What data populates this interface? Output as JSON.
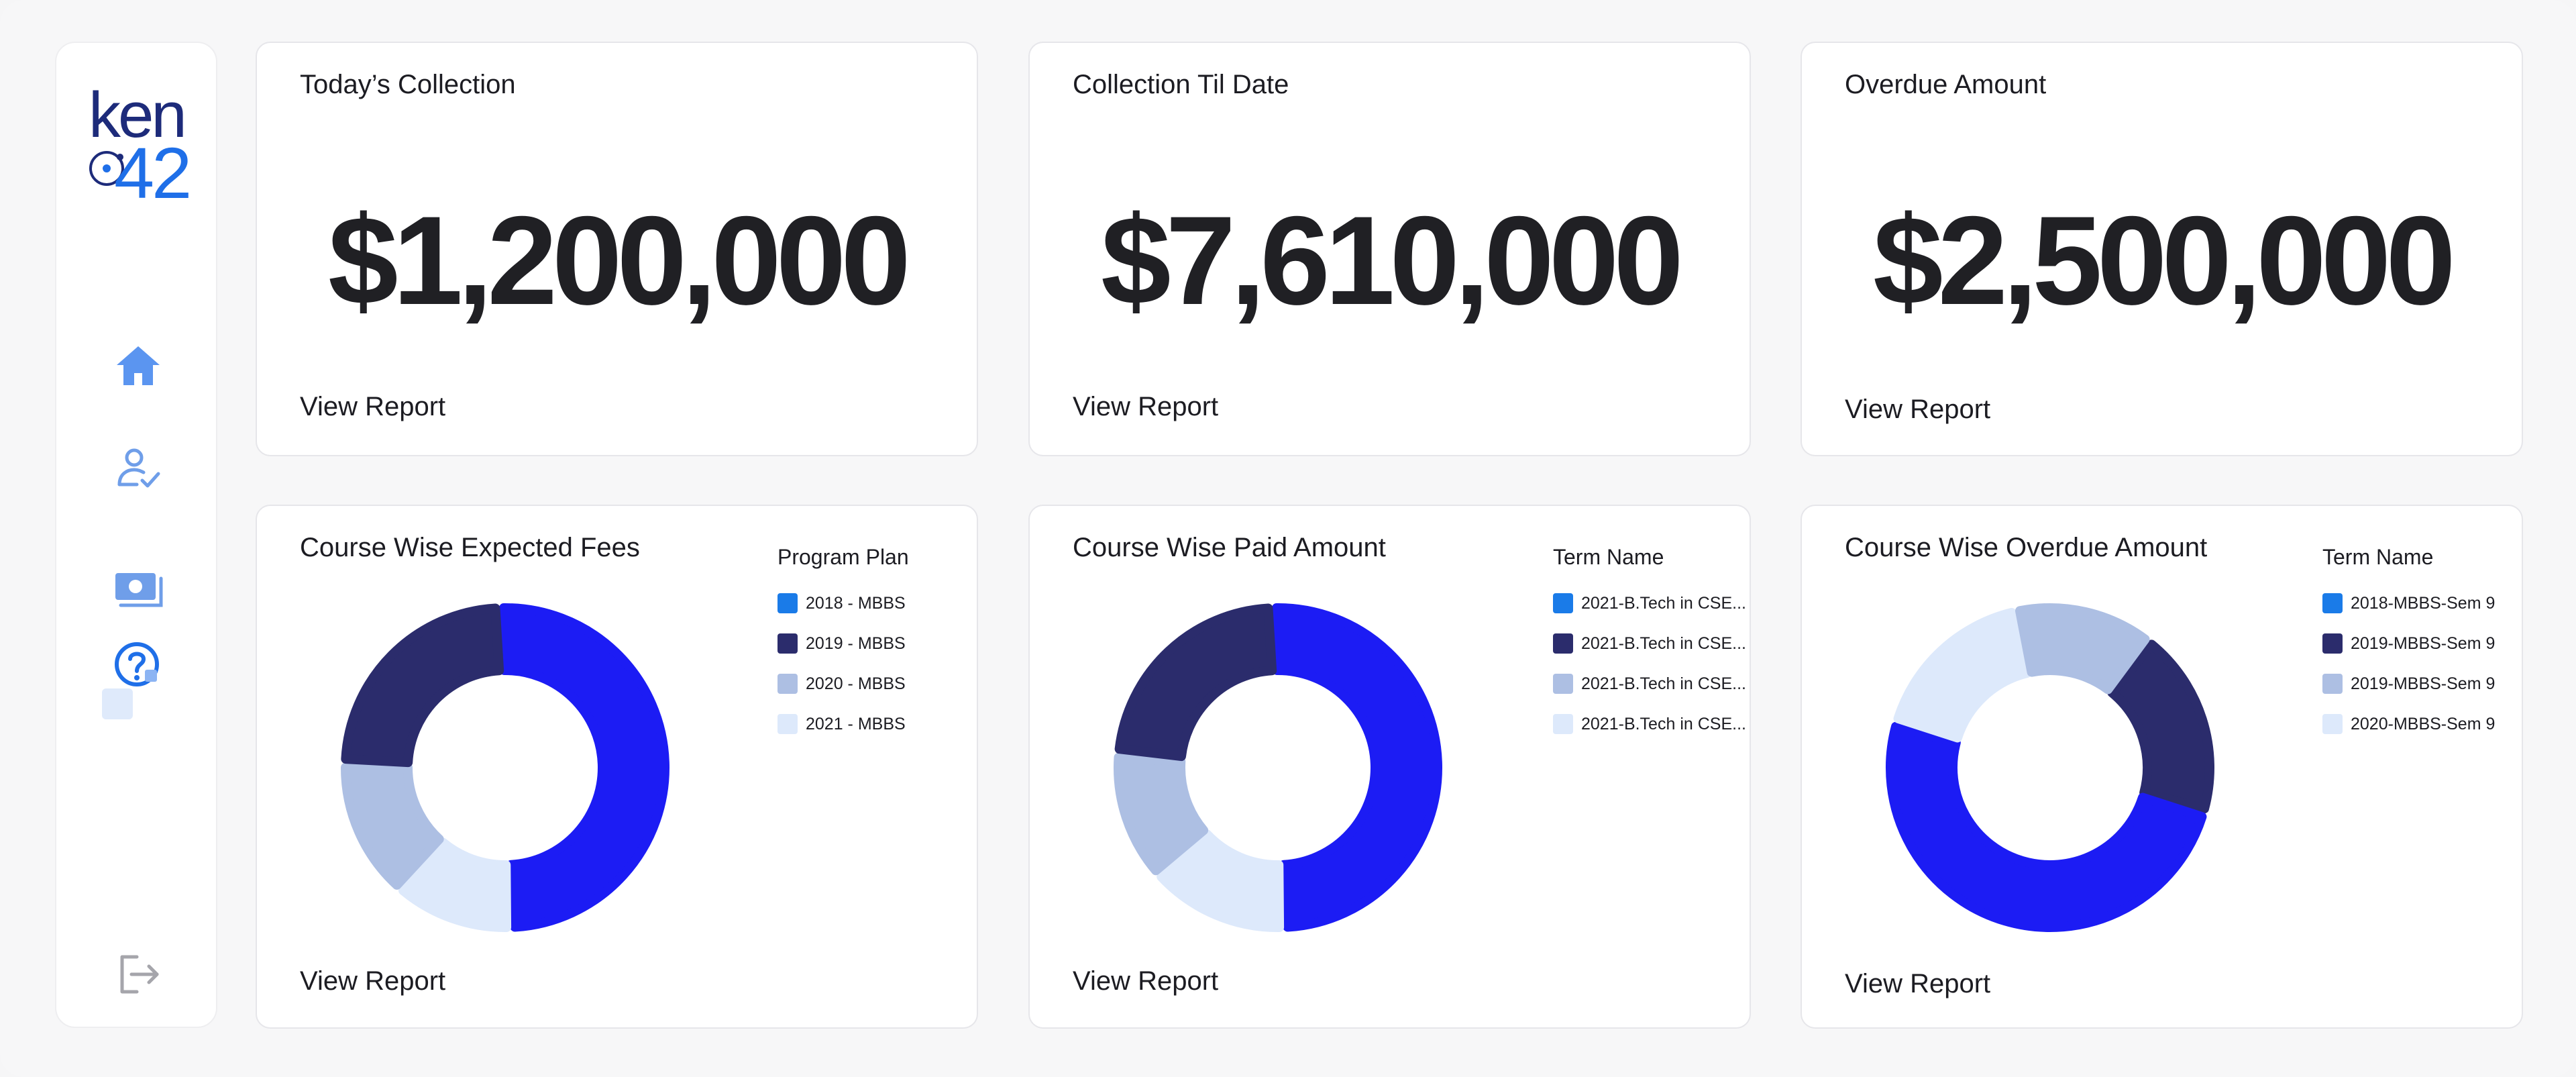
{
  "logo": {
    "line1": "ken",
    "line2": "42"
  },
  "sidebar": {
    "items": [
      {
        "name": "home",
        "icon": "home-icon"
      },
      {
        "name": "user-verified",
        "icon": "user-check-icon"
      },
      {
        "name": "payments",
        "icon": "cash-icon"
      },
      {
        "name": "help",
        "icon": "help-icon"
      },
      {
        "name": "logout",
        "icon": "logout-icon"
      }
    ]
  },
  "colors": {
    "accent_blue": "#1c1cf4",
    "navy": "#2b2c6c",
    "light_blue": "#adbfe3",
    "pale_blue": "#dde9fb",
    "legend_blue": "#1a7be8",
    "nav_icon": "#6f9ee9"
  },
  "cards": {
    "today": {
      "title": "Today’s Collection",
      "amount": "$1,200,000",
      "link": "View Report"
    },
    "til_date": {
      "title": "Collection Til Date",
      "amount": "$7,610,000",
      "link": "View Report"
    },
    "overdue": {
      "title": "Overdue Amount",
      "amount": "$2,500,000",
      "link": "View Report"
    },
    "expected_fees": {
      "title": "Course Wise Expected Fees",
      "legend_title": "Program Plan",
      "legend": [
        "2018 - MBBS",
        "2019 - MBBS",
        "2020 - MBBS",
        "2021 - MBBS"
      ],
      "link": "View Report"
    },
    "paid_amount": {
      "title": "Course Wise Paid Amount",
      "legend_title": "Term Name",
      "legend": [
        "2021-B.Tech in CSE...",
        "2021-B.Tech in CSE...",
        "2021-B.Tech in CSE...",
        "2021-B.Tech in CSE..."
      ],
      "link": "View Report"
    },
    "overdue_amount": {
      "title": "Course Wise Overdue Amount",
      "legend_title": "Term Name",
      "legend": [
        "2018-MBBS-Sem 9",
        "2019-MBBS-Sem 9",
        "2019-MBBS-Sem 9",
        "2020-MBBS-Sem 9"
      ],
      "link": "View Report"
    }
  },
  "chart_data": [
    {
      "type": "pie",
      "title": "Course Wise Expected Fees",
      "legend_title": "Program Plan",
      "slices": [
        {
          "value": 50,
          "color": "#1c1cf4"
        },
        {
          "value": 12,
          "color": "#dde9fb"
        },
        {
          "value": 14,
          "color": "#adbfe3"
        },
        {
          "value": 24,
          "color": "#2b2c6c"
        }
      ]
    },
    {
      "type": "pie",
      "title": "Course Wise Paid Amount",
      "legend_title": "Term Name",
      "slices": [
        {
          "value": 50,
          "color": "#1c1cf4"
        },
        {
          "value": 14,
          "color": "#dde9fb"
        },
        {
          "value": 13,
          "color": "#adbfe3"
        },
        {
          "value": 23,
          "color": "#2b2c6c"
        }
      ]
    },
    {
      "type": "pie",
      "title": "Course Wise Overdue Amount",
      "legend_title": "Term Name",
      "slices": [
        {
          "value": 19,
          "color": "#2b2c6c"
        },
        {
          "value": 50,
          "color": "#1c1cf4"
        },
        {
          "value": 17,
          "color": "#dde9fb"
        },
        {
          "value": 14,
          "color": "#adbfe3"
        }
      ]
    }
  ]
}
